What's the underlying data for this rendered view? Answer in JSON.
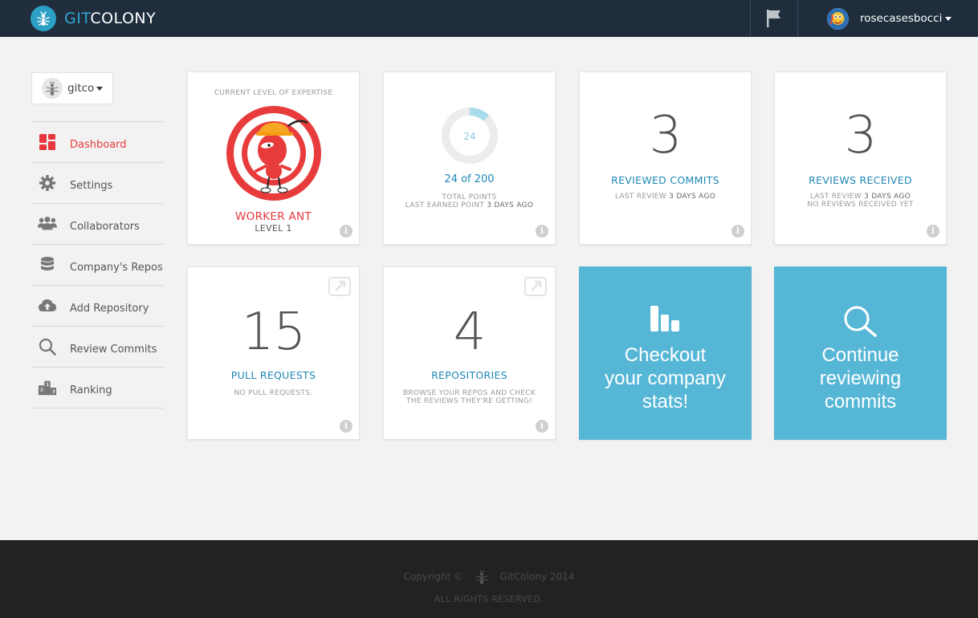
{
  "app": {
    "brand_git": "GIT",
    "brand_colony": "COLONY",
    "user_name": "rosecasesbocci"
  },
  "colors": {
    "topbar": "#1f2d3d",
    "accent_blue": "#1e87b5",
    "tile_blue": "#56b6d6",
    "active_red": "#e8383d"
  },
  "org": {
    "name": "gitco"
  },
  "nav": [
    {
      "label": "Dashboard",
      "icon": "dashboard-icon",
      "active": true
    },
    {
      "label": "Settings",
      "icon": "gear-icon",
      "active": false
    },
    {
      "label": "Collaborators",
      "icon": "users-icon",
      "active": false
    },
    {
      "label": "Company's Repos",
      "icon": "database-icon",
      "active": false
    },
    {
      "label": "Add Repository",
      "icon": "cloud-upload-icon",
      "active": false
    },
    {
      "label": "Review Commits",
      "icon": "search-icon",
      "active": false
    },
    {
      "label": "Ranking",
      "icon": "podium-icon",
      "active": false
    }
  ],
  "cards": {
    "expertise": {
      "heading": "CURRENT LEVEL OF EXPERTISE",
      "level_name": "WORKER ANT",
      "level": "LEVEL 1"
    },
    "points": {
      "ring_value": "24",
      "progress": 0.12,
      "summary": "24 of 200",
      "label": "TOTAL POINTS",
      "last_earned_prefix": "LAST EARNED POINT",
      "last_earned_value": "3 DAYS AGO"
    },
    "reviewed_commits": {
      "value": "3",
      "title": "REVIEWED COMMITS",
      "sub_prefix": "LAST REVIEW",
      "sub_value": "3 DAYS AGO"
    },
    "reviews_received": {
      "value": "3",
      "title": "REVIEWS RECEIVED",
      "sub_prefix": "LAST REVIEW",
      "sub_value": "3 DAYS AGO",
      "sub2": "NO REVIEWS RECEIVED YET"
    },
    "pull_requests": {
      "value": "15",
      "title": "PULL REQUESTS",
      "sub": "NO PULL REQUESTS."
    },
    "repositories": {
      "value": "4",
      "title": "REPOSITORIES",
      "sub_line1": "BROWSE YOUR REPOS AND CHECK",
      "sub_line2": "THE REVIEWS THEY'RE GETTING!"
    },
    "stats_cta": {
      "line1": "Checkout",
      "line2": "your company",
      "line3": "stats!"
    },
    "review_cta": {
      "line1": "Continue",
      "line2": "reviewing",
      "line3": "commits"
    }
  },
  "info_glyph": "i",
  "footer": {
    "copyright_prefix": "Copyright ©",
    "copyright_suffix": "GitColony 2014",
    "rights": "ALL RIGHTS RESERVED."
  }
}
